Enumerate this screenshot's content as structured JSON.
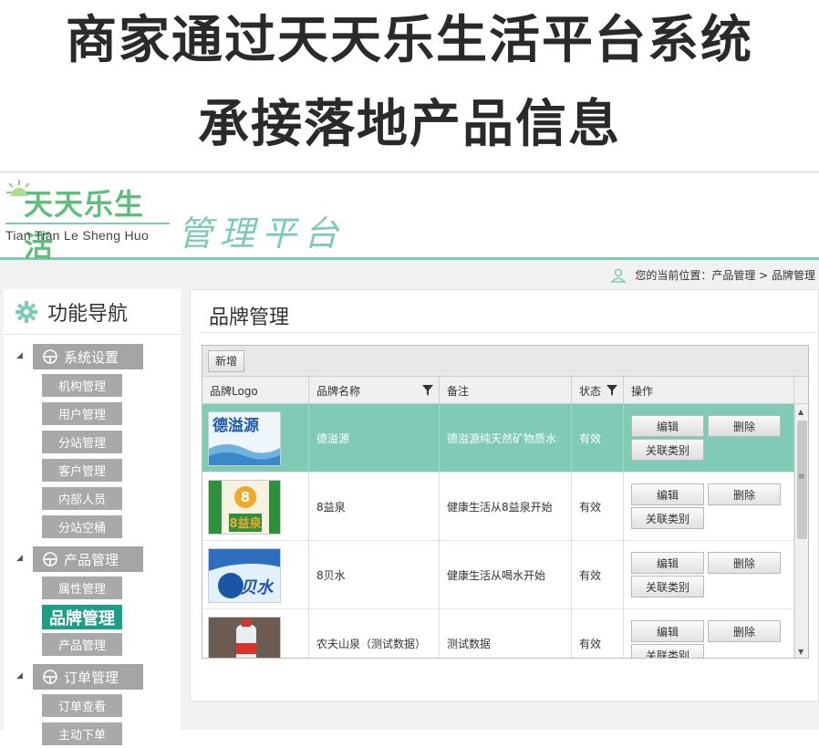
{
  "caption": {
    "line1": "商家通过天天乐生活平台系统",
    "line2": "承接落地产品信息"
  },
  "header": {
    "logo_cn": "天天乐生活",
    "logo_en": "Tian Tian Le Sheng Huo",
    "platform": "管理平台",
    "accent": "#7ecab9"
  },
  "breadcrumb": {
    "text": "您的当前位置：产品管理 > 品牌管理"
  },
  "sidebar": {
    "title": "功能导航",
    "groups": [
      {
        "label": "系统设置",
        "items": [
          "机构管理",
          "用户管理",
          "分站管理",
          "客户管理",
          "内部人员",
          "分站空桶"
        ]
      },
      {
        "label": "产品管理",
        "items": [
          "属性管理",
          "品牌管理",
          "产品管理"
        ],
        "active": "品牌管理"
      },
      {
        "label": "订单管理",
        "items": [
          "订单查看",
          "主动下单"
        ]
      }
    ]
  },
  "main": {
    "title": "品牌管理",
    "toolbar": {
      "add_label": "新增"
    },
    "columns": [
      "品牌Logo",
      "品牌名称",
      "备注",
      "状态",
      "操作"
    ],
    "rows": [
      {
        "name": "德溢源",
        "remark": "德溢源纯天然矿物质水",
        "status": "有效",
        "selected": true,
        "logo": "德溢源"
      },
      {
        "name": "8益泉",
        "remark": "健康生活从8益泉开始",
        "status": "有效",
        "selected": false,
        "logo": "8益泉"
      },
      {
        "name": "8贝水",
        "remark": "健康生活从喝水开始",
        "status": "有效",
        "selected": false,
        "logo": "8贝水"
      },
      {
        "name": "农夫山泉（测试数据）",
        "remark": "测试数据",
        "status": "有效",
        "selected": false,
        "logo": ""
      }
    ],
    "actions": {
      "edit": "编辑",
      "delete": "删除",
      "relate": "关联类别"
    },
    "selected_row_color": "#80cbb6"
  }
}
